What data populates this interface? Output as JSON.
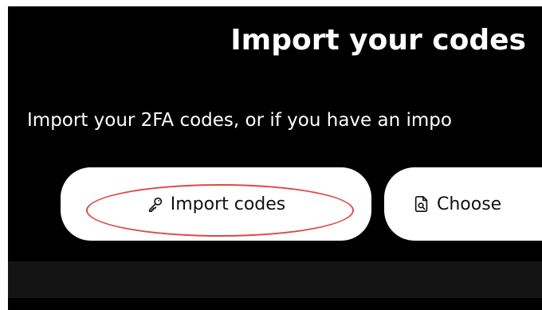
{
  "header": {
    "title": "Import your codes"
  },
  "description": "Import your 2FA codes, or if you have an impo",
  "buttons": {
    "import_label": "Import codes",
    "choose_label": "Choose",
    "import_icon": "key-icon",
    "choose_icon": "document-search-icon"
  },
  "colors": {
    "background": "#000000",
    "button_bg": "#ffffff",
    "highlight": "#e04848"
  }
}
